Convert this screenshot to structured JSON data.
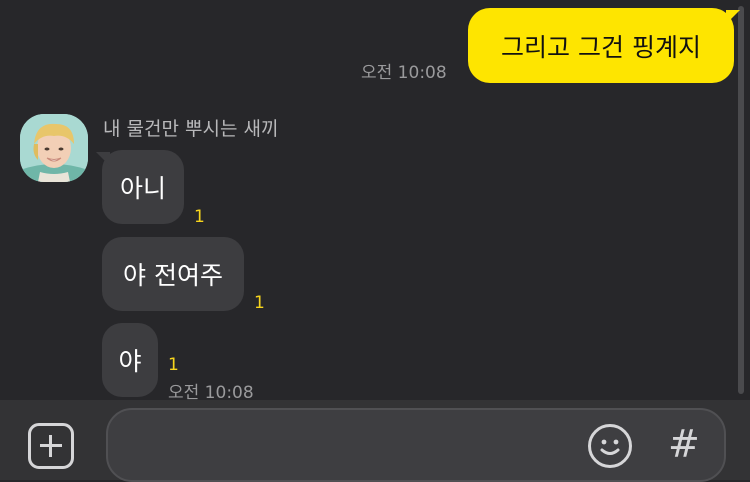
{
  "messages": {
    "outgoing": {
      "text": "그리고 그건 핑계지",
      "time": "오전 10:08"
    },
    "sender_name": "내 물건만 뿌시는 새끼",
    "incoming": [
      {
        "text": "아니",
        "unread": "1"
      },
      {
        "text": "야 전여주",
        "unread": "1"
      },
      {
        "text": "야",
        "unread": "1",
        "time": "오전 10:08"
      }
    ]
  },
  "composer": {
    "add_icon": "plus-square-icon",
    "emoji_icon": "smiley-icon",
    "hash_label": "#"
  },
  "colors": {
    "background": "#27272a",
    "my_bubble": "#fee500",
    "other_bubble": "#3d3d40",
    "unread": "#f7d51d"
  }
}
